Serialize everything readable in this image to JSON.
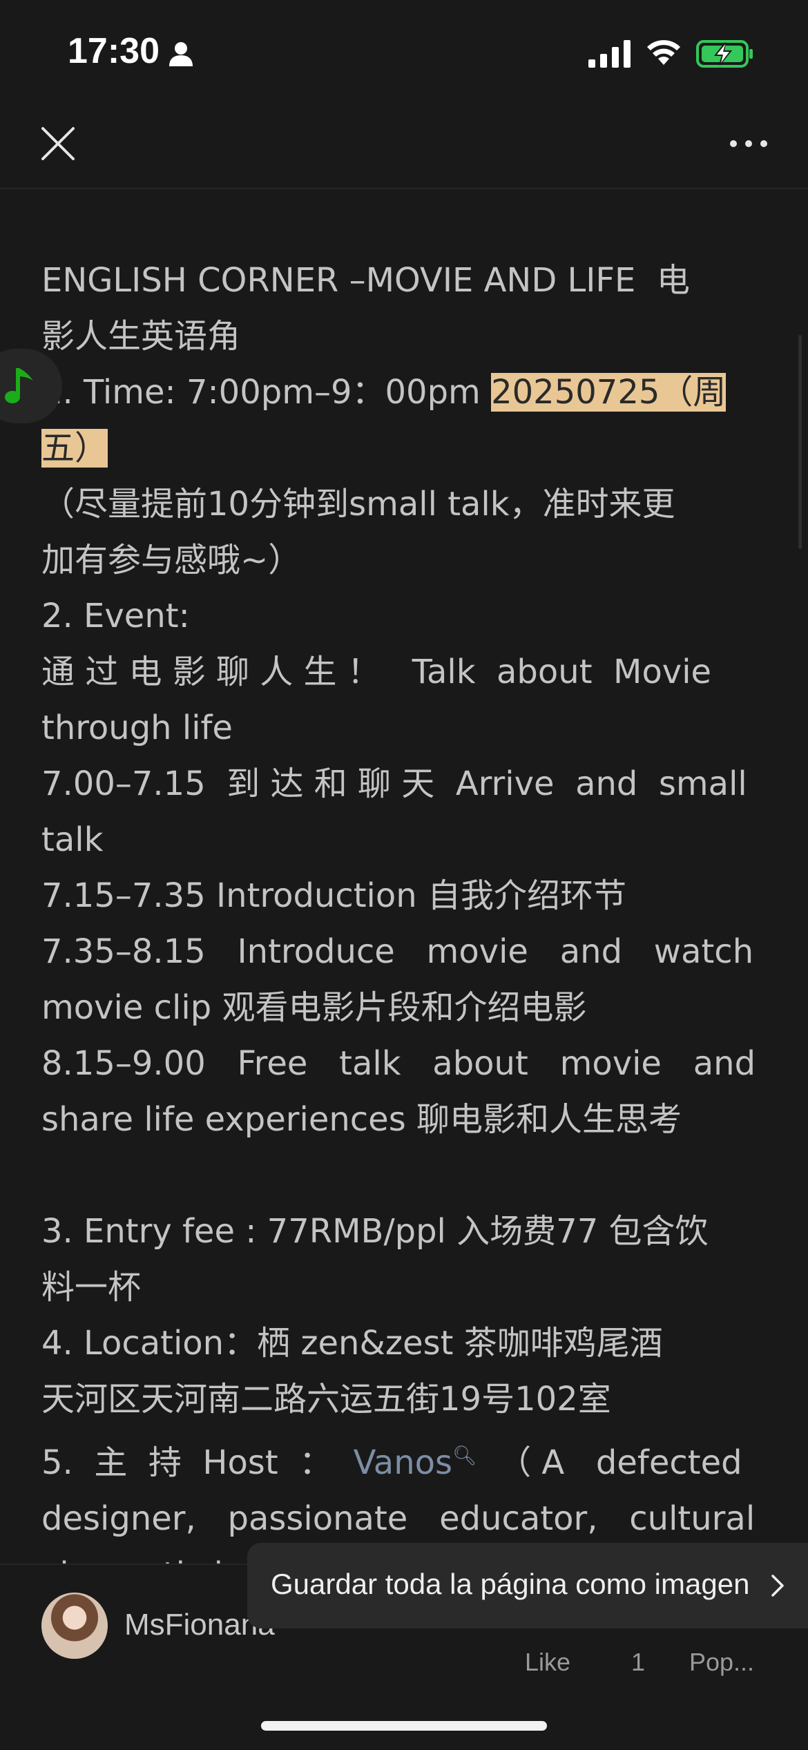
{
  "status_bar": {
    "time": "17:30"
  },
  "article": {
    "title_line1": "ENGLISH CORNER –MOVIE AND LIFE  电",
    "title_line2": "影人生英语角",
    "time_prefix": "1. Time: 7:00pm–9：00pm ",
    "time_date": "20250725（周",
    "time_date_cont": "五）",
    "note_line1": "（尽量提前10分钟到small talk，准时来更",
    "note_line2": "加有参与感哦~）",
    "event_heading": "2. Event:",
    "event_line1": "通 过 电 影 聊 人 生 ！   Talk  about  Movie",
    "event_line2": "through life",
    "schedule1_line1": "7.00–7.15  到 达 和 聊 天  Arrive  and  small",
    "schedule1_line2": "talk",
    "schedule2": "7.15–7.35 Introduction 自我介绍环节",
    "schedule3_line1": "7.35–8.15   Introduce   movie   and   watch",
    "schedule3_line2": "movie clip 观看电影片段和介绍电影",
    "schedule4_line1": "8.15–9.00   Free   talk   about   movie   and",
    "schedule4_line2": "share life experiences 聊电影和人生思考",
    "fee_line1": "3. Entry fee : 77RMB/ppl 入场费77 包含饮",
    "fee_line2": "料一杯",
    "location_line1": "4. Location：栖 zen&zest 茶咖啡鸡尾酒",
    "location_line2": "天河区天河南二路六运五街19号102室",
    "host_prefix": "5.  主  持  Host  ：  ",
    "host_name": "Vanos",
    "host_suffix": "  （ A   defected",
    "host_line2": "designer,   passionate   educator,   cultural",
    "host_line3": "cinematic lo"
  },
  "bottom_bar": {
    "author": "MsFionana",
    "like_label": "Like",
    "count": "1",
    "popular_label": "Pop..."
  },
  "toast": {
    "text": "Guardar toda la página como imagen"
  },
  "colors": {
    "background": "#191919",
    "highlight": "#e9c795",
    "link": "#7d8ea6",
    "music_green": "#1aad19",
    "battery_green": "#34c759"
  }
}
